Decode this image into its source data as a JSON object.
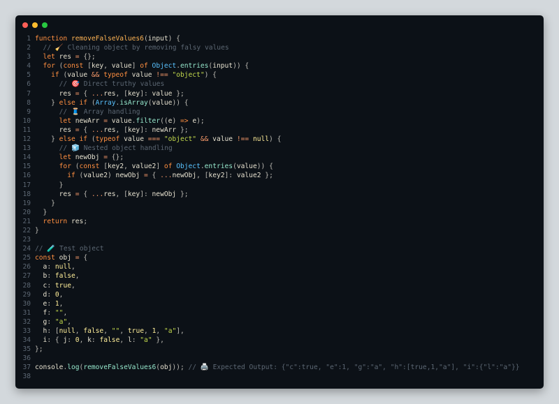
{
  "window": {
    "buttons": [
      "close",
      "minimize",
      "maximize"
    ]
  },
  "code_lines": [
    [
      {
        "t": "kw",
        "v": "function "
      },
      {
        "t": "fn",
        "v": "removeFalseValues6"
      },
      {
        "t": "punct",
        "v": "("
      },
      {
        "t": "var",
        "v": "input"
      },
      {
        "t": "punct",
        "v": ") {"
      }
    ],
    [
      {
        "t": "com",
        "v": "  // 🧹 Cleaning object by removing falsy values"
      }
    ],
    [
      {
        "t": "kw",
        "v": "  let "
      },
      {
        "t": "var",
        "v": "res "
      },
      {
        "t": "op",
        "v": "= "
      },
      {
        "t": "punct",
        "v": "{};"
      }
    ],
    [
      {
        "t": "kw",
        "v": "  for "
      },
      {
        "t": "punct",
        "v": "("
      },
      {
        "t": "kw",
        "v": "const "
      },
      {
        "t": "punct",
        "v": "["
      },
      {
        "t": "var",
        "v": "key"
      },
      {
        "t": "punct",
        "v": ", "
      },
      {
        "t": "var",
        "v": "value"
      },
      {
        "t": "punct",
        "v": "] "
      },
      {
        "t": "kw",
        "v": "of "
      },
      {
        "t": "obj",
        "v": "Object"
      },
      {
        "t": "punct",
        "v": "."
      },
      {
        "t": "call",
        "v": "entries"
      },
      {
        "t": "punct",
        "v": "("
      },
      {
        "t": "var",
        "v": "input"
      },
      {
        "t": "punct",
        "v": ")) {"
      }
    ],
    [
      {
        "t": "kw",
        "v": "    if "
      },
      {
        "t": "punct",
        "v": "("
      },
      {
        "t": "var",
        "v": "value "
      },
      {
        "t": "op",
        "v": "&& "
      },
      {
        "t": "kw",
        "v": "typeof "
      },
      {
        "t": "var",
        "v": "value "
      },
      {
        "t": "op",
        "v": "!== "
      },
      {
        "t": "str",
        "v": "\"object\""
      },
      {
        "t": "punct",
        "v": ") {"
      }
    ],
    [
      {
        "t": "com",
        "v": "      // 🎯 Direct truthy values"
      }
    ],
    [
      {
        "t": "var",
        "v": "      res "
      },
      {
        "t": "op",
        "v": "= "
      },
      {
        "t": "punct",
        "v": "{ "
      },
      {
        "t": "op",
        "v": "..."
      },
      {
        "t": "var",
        "v": "res"
      },
      {
        "t": "punct",
        "v": ", ["
      },
      {
        "t": "var",
        "v": "key"
      },
      {
        "t": "punct",
        "v": "]: "
      },
      {
        "t": "var",
        "v": "value "
      },
      {
        "t": "punct",
        "v": "};"
      }
    ],
    [
      {
        "t": "punct",
        "v": "    } "
      },
      {
        "t": "kw",
        "v": "else if "
      },
      {
        "t": "punct",
        "v": "("
      },
      {
        "t": "obj",
        "v": "Array"
      },
      {
        "t": "punct",
        "v": "."
      },
      {
        "t": "call",
        "v": "isArray"
      },
      {
        "t": "punct",
        "v": "("
      },
      {
        "t": "var",
        "v": "value"
      },
      {
        "t": "punct",
        "v": ")) {"
      }
    ],
    [
      {
        "t": "com",
        "v": "      // 🧵 Array handling"
      }
    ],
    [
      {
        "t": "kw",
        "v": "      let "
      },
      {
        "t": "var",
        "v": "newArr "
      },
      {
        "t": "op",
        "v": "= "
      },
      {
        "t": "var",
        "v": "value"
      },
      {
        "t": "punct",
        "v": "."
      },
      {
        "t": "call",
        "v": "filter"
      },
      {
        "t": "punct",
        "v": "(("
      },
      {
        "t": "var",
        "v": "e"
      },
      {
        "t": "punct",
        "v": ") "
      },
      {
        "t": "kw",
        "v": "=> "
      },
      {
        "t": "var",
        "v": "e"
      },
      {
        "t": "punct",
        "v": ");"
      }
    ],
    [
      {
        "t": "var",
        "v": "      res "
      },
      {
        "t": "op",
        "v": "= "
      },
      {
        "t": "punct",
        "v": "{ "
      },
      {
        "t": "op",
        "v": "..."
      },
      {
        "t": "var",
        "v": "res"
      },
      {
        "t": "punct",
        "v": ", ["
      },
      {
        "t": "var",
        "v": "key"
      },
      {
        "t": "punct",
        "v": "]: "
      },
      {
        "t": "var",
        "v": "newArr "
      },
      {
        "t": "punct",
        "v": "};"
      }
    ],
    [
      {
        "t": "punct",
        "v": "    } "
      },
      {
        "t": "kw",
        "v": "else if "
      },
      {
        "t": "punct",
        "v": "("
      },
      {
        "t": "kw",
        "v": "typeof "
      },
      {
        "t": "var",
        "v": "value "
      },
      {
        "t": "op",
        "v": "=== "
      },
      {
        "t": "str",
        "v": "\"object\" "
      },
      {
        "t": "op",
        "v": "&& "
      },
      {
        "t": "var",
        "v": "value "
      },
      {
        "t": "op",
        "v": "!== "
      },
      {
        "t": "lit",
        "v": "null"
      },
      {
        "t": "punct",
        "v": ") {"
      }
    ],
    [
      {
        "t": "com",
        "v": "      // 🧊 Nested object handling"
      }
    ],
    [
      {
        "t": "kw",
        "v": "      let "
      },
      {
        "t": "var",
        "v": "newObj "
      },
      {
        "t": "op",
        "v": "= "
      },
      {
        "t": "punct",
        "v": "{};"
      }
    ],
    [
      {
        "t": "kw",
        "v": "      for "
      },
      {
        "t": "punct",
        "v": "("
      },
      {
        "t": "kw",
        "v": "const "
      },
      {
        "t": "punct",
        "v": "["
      },
      {
        "t": "var",
        "v": "key2"
      },
      {
        "t": "punct",
        "v": ", "
      },
      {
        "t": "var",
        "v": "value2"
      },
      {
        "t": "punct",
        "v": "] "
      },
      {
        "t": "kw",
        "v": "of "
      },
      {
        "t": "obj",
        "v": "Object"
      },
      {
        "t": "punct",
        "v": "."
      },
      {
        "t": "call",
        "v": "entries"
      },
      {
        "t": "punct",
        "v": "("
      },
      {
        "t": "var",
        "v": "value"
      },
      {
        "t": "punct",
        "v": ")) {"
      }
    ],
    [
      {
        "t": "kw",
        "v": "        if "
      },
      {
        "t": "punct",
        "v": "("
      },
      {
        "t": "var",
        "v": "value2"
      },
      {
        "t": "punct",
        "v": ") "
      },
      {
        "t": "var",
        "v": "newObj "
      },
      {
        "t": "op",
        "v": "= "
      },
      {
        "t": "punct",
        "v": "{ "
      },
      {
        "t": "op",
        "v": "..."
      },
      {
        "t": "var",
        "v": "newObj"
      },
      {
        "t": "punct",
        "v": ", ["
      },
      {
        "t": "var",
        "v": "key2"
      },
      {
        "t": "punct",
        "v": "]: "
      },
      {
        "t": "var",
        "v": "value2 "
      },
      {
        "t": "punct",
        "v": "};"
      }
    ],
    [
      {
        "t": "punct",
        "v": "      }"
      }
    ],
    [
      {
        "t": "var",
        "v": "      res "
      },
      {
        "t": "op",
        "v": "= "
      },
      {
        "t": "punct",
        "v": "{ "
      },
      {
        "t": "op",
        "v": "..."
      },
      {
        "t": "var",
        "v": "res"
      },
      {
        "t": "punct",
        "v": ", ["
      },
      {
        "t": "var",
        "v": "key"
      },
      {
        "t": "punct",
        "v": "]: "
      },
      {
        "t": "var",
        "v": "newObj "
      },
      {
        "t": "punct",
        "v": "};"
      }
    ],
    [
      {
        "t": "punct",
        "v": "    }"
      }
    ],
    [
      {
        "t": "punct",
        "v": "  }"
      }
    ],
    [
      {
        "t": "kw",
        "v": "  return "
      },
      {
        "t": "var",
        "v": "res"
      },
      {
        "t": "punct",
        "v": ";"
      }
    ],
    [
      {
        "t": "punct",
        "v": "}"
      }
    ],
    [],
    [
      {
        "t": "com",
        "v": "// 🧪 Test object"
      }
    ],
    [
      {
        "t": "kw",
        "v": "const "
      },
      {
        "t": "var",
        "v": "obj "
      },
      {
        "t": "op",
        "v": "= "
      },
      {
        "t": "punct",
        "v": "{"
      }
    ],
    [
      {
        "t": "prop",
        "v": "  a"
      },
      {
        "t": "punct",
        "v": ": "
      },
      {
        "t": "lit",
        "v": "null"
      },
      {
        "t": "punct",
        "v": ","
      }
    ],
    [
      {
        "t": "prop",
        "v": "  b"
      },
      {
        "t": "punct",
        "v": ": "
      },
      {
        "t": "lit",
        "v": "false"
      },
      {
        "t": "punct",
        "v": ","
      }
    ],
    [
      {
        "t": "prop",
        "v": "  c"
      },
      {
        "t": "punct",
        "v": ": "
      },
      {
        "t": "lit",
        "v": "true"
      },
      {
        "t": "punct",
        "v": ","
      }
    ],
    [
      {
        "t": "prop",
        "v": "  d"
      },
      {
        "t": "punct",
        "v": ": "
      },
      {
        "t": "num",
        "v": "0"
      },
      {
        "t": "punct",
        "v": ","
      }
    ],
    [
      {
        "t": "prop",
        "v": "  e"
      },
      {
        "t": "punct",
        "v": ": "
      },
      {
        "t": "num",
        "v": "1"
      },
      {
        "t": "punct",
        "v": ","
      }
    ],
    [
      {
        "t": "prop",
        "v": "  f"
      },
      {
        "t": "punct",
        "v": ": "
      },
      {
        "t": "str",
        "v": "\"\""
      },
      {
        "t": "punct",
        "v": ","
      }
    ],
    [
      {
        "t": "prop",
        "v": "  g"
      },
      {
        "t": "punct",
        "v": ": "
      },
      {
        "t": "str",
        "v": "\"a\""
      },
      {
        "t": "punct",
        "v": ","
      }
    ],
    [
      {
        "t": "prop",
        "v": "  h"
      },
      {
        "t": "punct",
        "v": ": ["
      },
      {
        "t": "lit",
        "v": "null"
      },
      {
        "t": "punct",
        "v": ", "
      },
      {
        "t": "lit",
        "v": "false"
      },
      {
        "t": "punct",
        "v": ", "
      },
      {
        "t": "str",
        "v": "\"\""
      },
      {
        "t": "punct",
        "v": ", "
      },
      {
        "t": "lit",
        "v": "true"
      },
      {
        "t": "punct",
        "v": ", "
      },
      {
        "t": "num",
        "v": "1"
      },
      {
        "t": "punct",
        "v": ", "
      },
      {
        "t": "str",
        "v": "\"a\""
      },
      {
        "t": "punct",
        "v": "],"
      }
    ],
    [
      {
        "t": "prop",
        "v": "  i"
      },
      {
        "t": "punct",
        "v": ": { "
      },
      {
        "t": "prop",
        "v": "j"
      },
      {
        "t": "punct",
        "v": ": "
      },
      {
        "t": "num",
        "v": "0"
      },
      {
        "t": "punct",
        "v": ", "
      },
      {
        "t": "prop",
        "v": "k"
      },
      {
        "t": "punct",
        "v": ": "
      },
      {
        "t": "lit",
        "v": "false"
      },
      {
        "t": "punct",
        "v": ", "
      },
      {
        "t": "prop",
        "v": "l"
      },
      {
        "t": "punct",
        "v": ": "
      },
      {
        "t": "str",
        "v": "\"a\" "
      },
      {
        "t": "punct",
        "v": "},"
      }
    ],
    [
      {
        "t": "punct",
        "v": "};"
      }
    ],
    [],
    [
      {
        "t": "var",
        "v": "console"
      },
      {
        "t": "punct",
        "v": "."
      },
      {
        "t": "call",
        "v": "log"
      },
      {
        "t": "punct",
        "v": "("
      },
      {
        "t": "call",
        "v": "removeFalseValues6"
      },
      {
        "t": "punct",
        "v": "("
      },
      {
        "t": "var",
        "v": "obj"
      },
      {
        "t": "punct",
        "v": ")); "
      },
      {
        "t": "com",
        "v": "// 🖨️ Expected Output: {\"c\":true, \"e\":1, \"g\":\"a\", \"h\":[true,1,\"a\"], \"i\":{\"l\":\"a\"}}"
      }
    ],
    []
  ]
}
